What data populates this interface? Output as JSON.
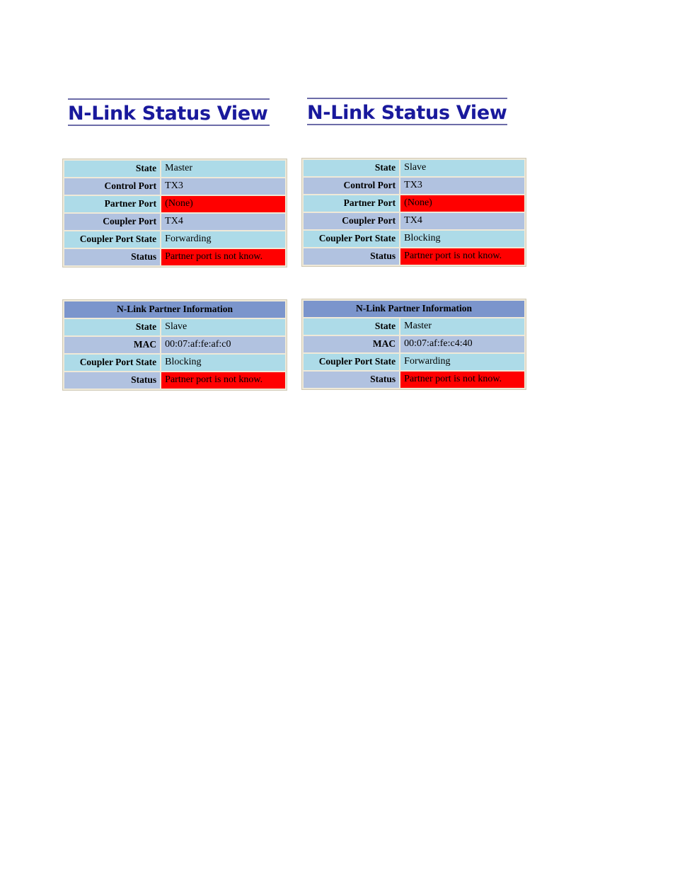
{
  "page": {
    "background": "#ffffff",
    "accent_title_color": "#19199c",
    "alert_color": "#ff0000",
    "row_color_a": "#addbe8",
    "row_color_b": "#b1c2e0",
    "table_header_color": "#7b95cc",
    "table_border_color": "#efe9d8"
  },
  "panels": [
    {
      "id": "left",
      "title": "N-Link Status View",
      "status_table": {
        "rows": [
          {
            "label": "State",
            "value": "Master",
            "alert": false
          },
          {
            "label": "Control Port",
            "value": "TX3",
            "alert": false
          },
          {
            "label": "Partner Port",
            "value": "(None)",
            "alert": true
          },
          {
            "label": "Coupler Port",
            "value": "TX4",
            "alert": false
          },
          {
            "label": "Coupler Port State",
            "value": "Forwarding",
            "alert": false
          },
          {
            "label": "Status",
            "value": "Partner port is not know.",
            "alert": true
          }
        ]
      },
      "partner_table": {
        "header": "N-Link Partner Information",
        "rows": [
          {
            "label": "State",
            "value": "Slave",
            "alert": false
          },
          {
            "label": "MAC",
            "value": "00:07:af:fe:af:c0",
            "alert": false
          },
          {
            "label": "Coupler Port State",
            "value": "Blocking",
            "alert": false
          },
          {
            "label": "Status",
            "value": "Partner port is not know.",
            "alert": true
          }
        ]
      }
    },
    {
      "id": "right",
      "title": "N-Link Status View",
      "status_table": {
        "rows": [
          {
            "label": "State",
            "value": "Slave",
            "alert": false
          },
          {
            "label": "Control Port",
            "value": "TX3",
            "alert": false
          },
          {
            "label": "Partner Port",
            "value": "(None)",
            "alert": true
          },
          {
            "label": "Coupler Port",
            "value": "TX4",
            "alert": false
          },
          {
            "label": "Coupler Port State",
            "value": "Blocking",
            "alert": false
          },
          {
            "label": "Status",
            "value": "Partner port is not know.",
            "alert": true
          }
        ]
      },
      "partner_table": {
        "header": "N-Link Partner Information",
        "rows": [
          {
            "label": "State",
            "value": "Master",
            "alert": false
          },
          {
            "label": "MAC",
            "value": "00:07:af:fe:c4:40",
            "alert": false
          },
          {
            "label": "Coupler Port State",
            "value": "Forwarding",
            "alert": false
          },
          {
            "label": "Status",
            "value": "Partner port is not know.",
            "alert": true
          }
        ]
      }
    }
  ]
}
